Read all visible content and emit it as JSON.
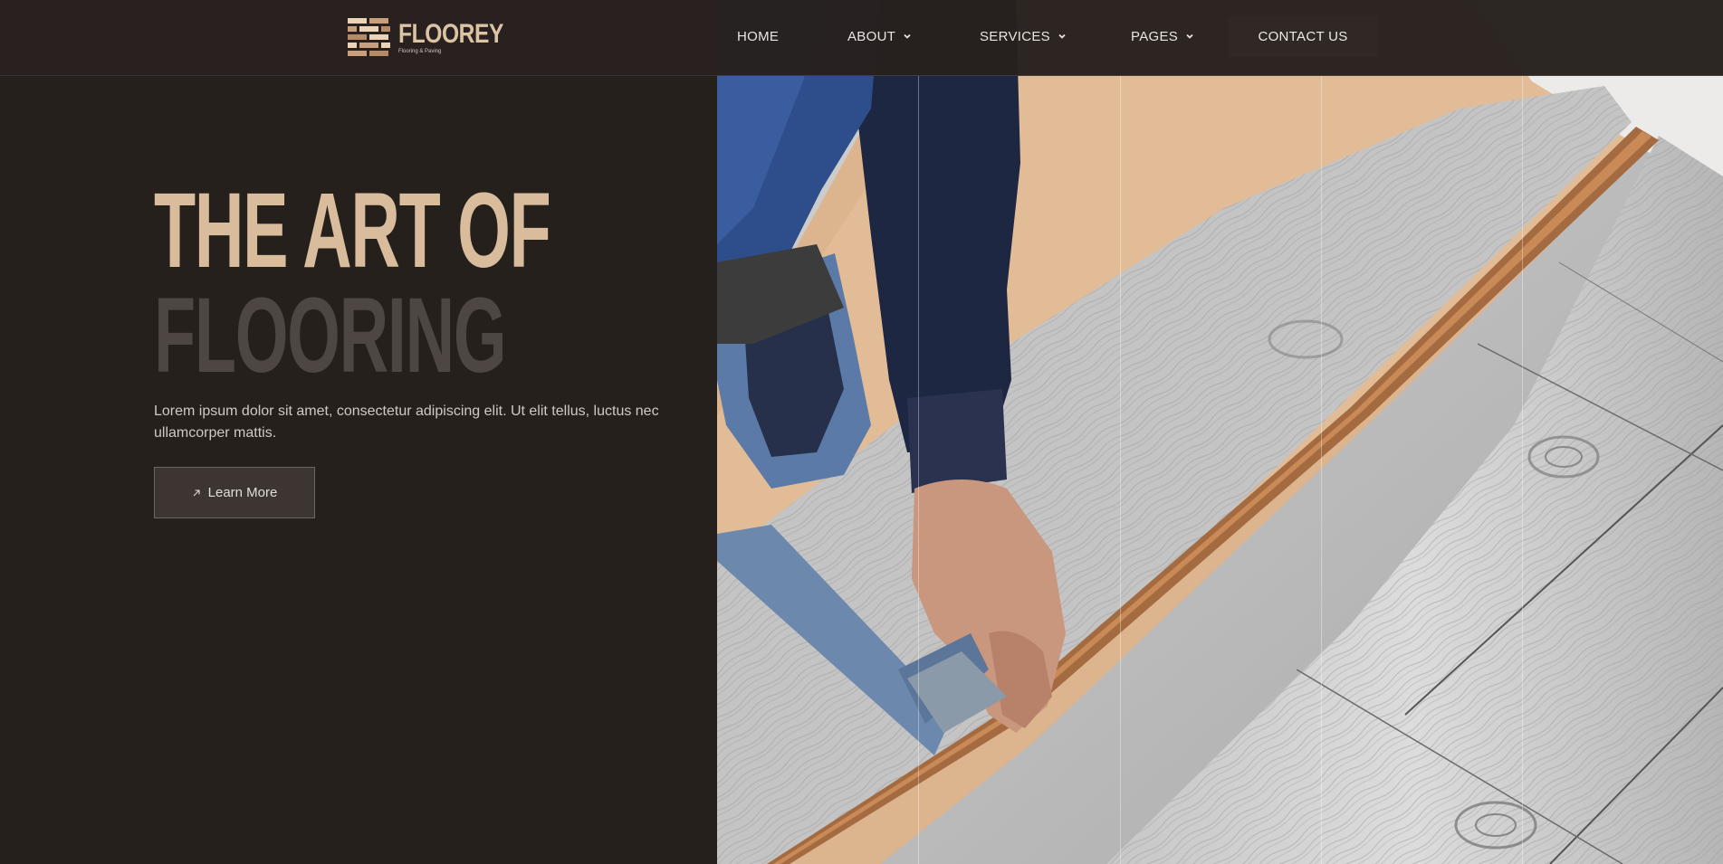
{
  "brand": {
    "name": "FLOOREY",
    "tagline": "Flooring & Paving",
    "icon": "brick-logo-icon"
  },
  "nav": {
    "items": [
      {
        "label": "HOME",
        "has_dropdown": false
      },
      {
        "label": "ABOUT",
        "has_dropdown": true
      },
      {
        "label": "SERVICES",
        "has_dropdown": true
      },
      {
        "label": "PAGES",
        "has_dropdown": true
      }
    ],
    "cta_label": "CONTACT US",
    "dropdown_icon": "chevron-down-icon"
  },
  "hero": {
    "title_line_1": "THE ART OF",
    "title_line_2": "FLOORING",
    "description": "Lorem ipsum dolor sit amet, consectetur adipiscing elit. Ut elit tellus, luctus nec ullamcorper mattis.",
    "button_label": "Learn More",
    "button_icon": "arrow-up-right-icon"
  },
  "image": {
    "subject": "worker-installing-laminate-flooring-photo"
  },
  "colors": {
    "background": "#26201d",
    "accent": "#d8bc9c",
    "muted_title": "#4d4643",
    "header": "#28221f",
    "button": "#3c3531"
  }
}
